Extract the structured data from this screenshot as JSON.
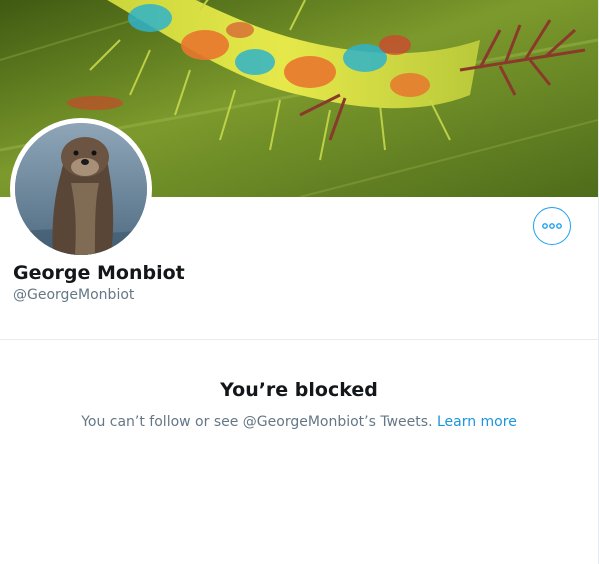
{
  "profile": {
    "display_name": "George Monbiot",
    "screen_name": "@GeorgeMonbiot"
  },
  "banner": {
    "image": "caterpillar-on-leaf-photo"
  },
  "avatar": {
    "image": "otter-in-water-photo"
  },
  "actions": {
    "more_icon": "more-horizontal-icon"
  },
  "blocked": {
    "title": "You’re blocked",
    "message": "You can’t follow or see @GeorgeMonbiot’s Tweets. ",
    "link_label": "Learn more"
  },
  "colors": {
    "accent": "#1da1f2",
    "link": "#1b95e0",
    "primary_text": "#14171a",
    "secondary_text": "#657786",
    "divider": "#e6ecf0"
  }
}
